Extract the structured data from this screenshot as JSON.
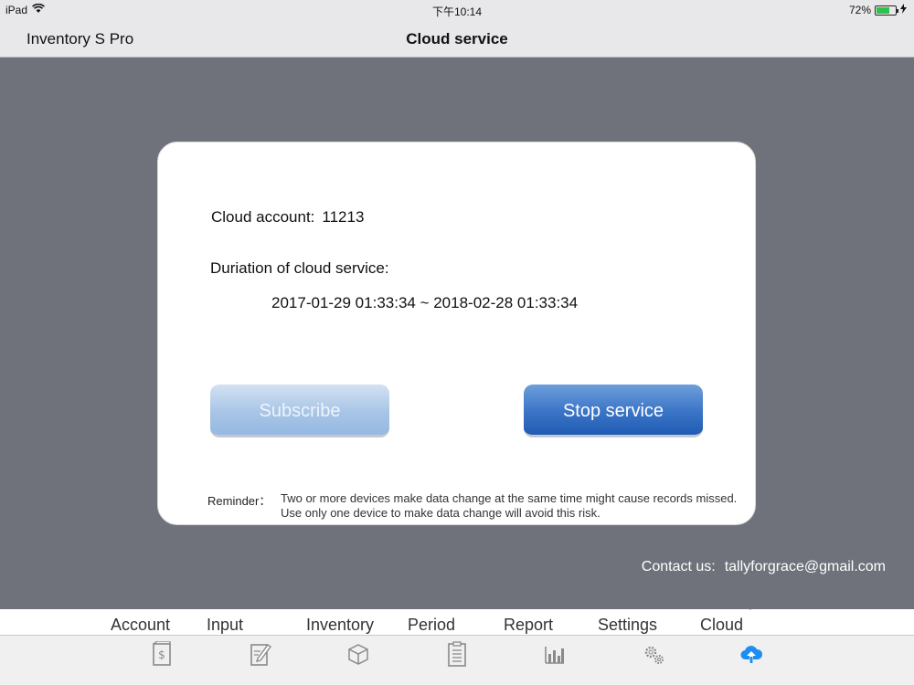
{
  "status_bar": {
    "device": "iPad",
    "time": "下午10:14",
    "battery": "72%",
    "battery_level": 0.72,
    "battery_color": "#2bc34a"
  },
  "nav_bar": {
    "app_name": "Inventory S Pro",
    "title": "Cloud service"
  },
  "card": {
    "account_label": "Cloud account:",
    "account_value": "11213",
    "duration_label": "Duriation of cloud service:",
    "duration_value": "2017-01-29 01:33:34 ~ 2018-02-28 01:33:34",
    "subscribe_label": "Subscribe",
    "stop_label": "Stop service",
    "reminder_label": "Reminder：",
    "reminder_text": "Two or more devices make data change at the same time might cause  records missed.  Use only one device to make data change will  avoid this risk."
  },
  "contact": {
    "label": "Contact us:",
    "email": "tallyforgrace@gmail.com"
  },
  "tabs": [
    {
      "label": "Account",
      "icon": "dollar-document-icon"
    },
    {
      "label": "Input",
      "icon": "edit-icon"
    },
    {
      "label": "Inventory",
      "icon": "box-icon"
    },
    {
      "label": "Period",
      "icon": "clipboard-icon"
    },
    {
      "label": "Report",
      "icon": "bar-chart-icon"
    },
    {
      "label": "Settings",
      "icon": "gears-icon"
    },
    {
      "label": "Cloud",
      "icon": "cloud-upload-icon",
      "active": true
    }
  ],
  "colors": {
    "background": "#6f727a",
    "active_tab": "#1e8ef2",
    "inactive_icon": "#9a9a9a",
    "stop_button": "#2c67bd",
    "subscribe_button": "#a8c5e6"
  }
}
